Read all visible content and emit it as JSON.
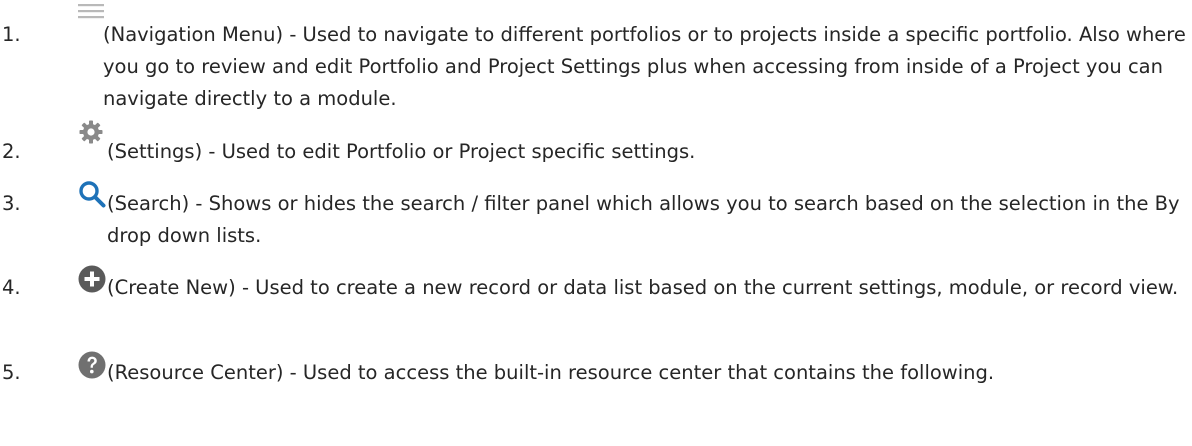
{
  "items": [
    {
      "number": "1.",
      "icon": "hamburger-menu-icon",
      "text": "(Navigation Menu) - Used to navigate to different portfolios or to projects inside a specific portfolio. Also where you go to review and edit Portfolio and Project Settings plus when accessing from inside of a Project you can navigate directly to a module."
    },
    {
      "number": "2.",
      "icon": "gear-icon",
      "text": "(Settings) - Used to edit Portfolio or Project specific settings."
    },
    {
      "number": "3.",
      "icon": "search-icon",
      "text": "(Search) - Shows or hides the search / filter panel which allows you to search based on the selection in the By drop down lists."
    },
    {
      "number": "4.",
      "icon": "plus-circle-icon",
      "text": "(Create New) - Used to create a new record or data list based on the current settings, module, or record view."
    },
    {
      "number": "5.",
      "icon": "question-circle-icon",
      "text": "(Resource Center) - Used to access the built-in resource center that contains the following."
    }
  ],
  "colors": {
    "text": "#262626",
    "icon_gray": "#8a8a8a",
    "hamburger": "#b9b9b9",
    "search_blue": "#1e72b8"
  }
}
